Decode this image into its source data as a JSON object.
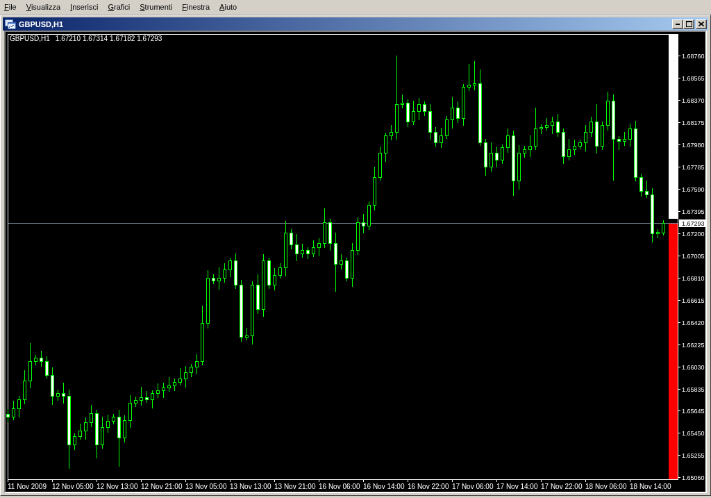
{
  "menu_bar": {
    "items": [
      "File",
      "Visualizza",
      "Inserisci",
      "Grafici",
      "Strumenti",
      "Finestra",
      "Aiuto"
    ]
  },
  "window": {
    "title": "GBPUSD,H1"
  },
  "chart": {
    "legend": {
      "values": [
        "1.67210",
        "1.67314",
        "1.67182",
        "1.67293"
      ]
    },
    "chart_data": {
      "type": "candlestick",
      "series": [
        {
          "name": "GBPUSD,H1",
          "color": "#00ff00",
          "ohlc": [
            [
              1.65616,
              1.65656,
              1.65541,
              1.65591
            ],
            [
              1.65591,
              1.65734,
              1.65561,
              1.65664
            ],
            [
              1.65664,
              1.65774,
              1.65584,
              1.65744
            ],
            [
              1.65744,
              1.65998,
              1.65699,
              1.65908
            ],
            [
              1.65908,
              1.66237,
              1.65843,
              1.66079
            ],
            [
              1.66079,
              1.66134,
              1.66044,
              1.66109
            ],
            [
              1.66109,
              1.66169,
              1.66029,
              1.66079
            ],
            [
              1.66079,
              1.66119,
              1.65927,
              1.65957
            ],
            [
              1.65957,
              1.66027,
              1.65694,
              1.65774
            ],
            [
              1.65774,
              1.65828,
              1.65729,
              1.65798
            ],
            [
              1.65798,
              1.65888,
              1.65709,
              1.65774
            ],
            [
              1.65774,
              1.65829,
              1.65134,
              1.65348
            ],
            [
              1.65348,
              1.65446,
              1.65298,
              1.65421
            ],
            [
              1.65421,
              1.65529,
              1.65391,
              1.65469
            ],
            [
              1.65469,
              1.65583,
              1.65389,
              1.65543
            ],
            [
              1.65543,
              1.65692,
              1.65498,
              1.65622
            ],
            [
              1.65622,
              1.65652,
              1.65226,
              1.65348
            ],
            [
              1.65348,
              1.6559,
              1.65313,
              1.655
            ],
            [
              1.655,
              1.6561,
              1.6545,
              1.65555
            ],
            [
              1.65555,
              1.65616,
              1.65525,
              1.65591
            ],
            [
              1.65591,
              1.65651,
              1.65153,
              1.65408
            ],
            [
              1.65408,
              1.65601,
              1.65363,
              1.65561
            ],
            [
              1.65561,
              1.65783,
              1.65496,
              1.65713
            ],
            [
              1.65713,
              1.65768,
              1.65678,
              1.65738
            ],
            [
              1.65738,
              1.65852,
              1.65688,
              1.65762
            ],
            [
              1.65762,
              1.65817,
              1.65714,
              1.65744
            ],
            [
              1.65744,
              1.65823,
              1.65664,
              1.65798
            ],
            [
              1.65798,
              1.65883,
              1.65753,
              1.65823
            ],
            [
              1.65823,
              1.65887,
              1.65758,
              1.65847
            ],
            [
              1.65847,
              1.65936,
              1.65812,
              1.65866
            ],
            [
              1.65866,
              1.65926,
              1.65816,
              1.65896
            ],
            [
              1.65896,
              1.66016,
              1.65866,
              1.65926
            ],
            [
              1.65926,
              1.66036,
              1.65846,
              1.65981
            ],
            [
              1.65981,
              1.66055,
              1.65936,
              1.6603
            ],
            [
              1.6603,
              1.66139,
              1.65965,
              1.66079
            ],
            [
              1.66079,
              1.66566,
              1.66044,
              1.66414
            ],
            [
              1.66414,
              1.6688,
              1.66364,
              1.6681
            ],
            [
              1.6681,
              1.6684,
              1.66756,
              1.66786
            ],
            [
              1.66786,
              1.669,
              1.66706,
              1.6681
            ],
            [
              1.6681,
              1.66938,
              1.66765,
              1.66883
            ],
            [
              1.66883,
              1.66987,
              1.66818,
              1.66962
            ],
            [
              1.66962,
              1.67022,
              1.66714,
              1.66749
            ],
            [
              1.66749,
              1.66789,
              1.66249,
              1.66292
            ],
            [
              1.66292,
              1.66374,
              1.66262,
              1.66304
            ],
            [
              1.66304,
              1.66779,
              1.66224,
              1.66749
            ],
            [
              1.66749,
              1.66839,
              1.66491,
              1.66536
            ],
            [
              1.66536,
              1.67017,
              1.66471,
              1.66962
            ],
            [
              1.66962,
              1.66987,
              1.66714,
              1.66749
            ],
            [
              1.66749,
              1.66894,
              1.66699,
              1.66834
            ],
            [
              1.66834,
              1.66941,
              1.66804,
              1.66901
            ],
            [
              1.66901,
              1.6731,
              1.66821,
              1.67206
            ],
            [
              1.67206,
              1.67236,
              1.67058,
              1.67103
            ],
            [
              1.67103,
              1.67193,
              1.66958,
              1.67023
            ],
            [
              1.67023,
              1.67109,
              1.66988,
              1.67054
            ],
            [
              1.67054,
              1.67079,
              1.66973,
              1.67023
            ],
            [
              1.67023,
              1.67138,
              1.66993,
              1.67078
            ],
            [
              1.67078,
              1.67155,
              1.66998,
              1.67115
            ],
            [
              1.67115,
              1.67419,
              1.6707,
              1.67298
            ],
            [
              1.67298,
              1.67328,
              1.6705,
              1.67115
            ],
            [
              1.67115,
              1.67205,
              1.66688,
              1.66932
            ],
            [
              1.66932,
              1.67017,
              1.66882,
              1.66962
            ],
            [
              1.66962,
              1.66987,
              1.6678,
              1.6681
            ],
            [
              1.6681,
              1.67114,
              1.6673,
              1.67054
            ],
            [
              1.67054,
              1.67338,
              1.67009,
              1.67298
            ],
            [
              1.67298,
              1.67368,
              1.67202,
              1.67267
            ],
            [
              1.67267,
              1.6748,
              1.67232,
              1.6745
            ],
            [
              1.6745,
              1.67784,
              1.674,
              1.67694
            ],
            [
              1.67694,
              1.67962,
              1.67664,
              1.67907
            ],
            [
              1.67907,
              1.68084,
              1.67827,
              1.68059
            ],
            [
              1.68059,
              1.6815,
              1.68014,
              1.6809
            ],
            [
              1.6809,
              1.6876,
              1.68025,
              1.68333
            ],
            [
              1.68333,
              1.68416,
              1.68298,
              1.68346
            ],
            [
              1.68346,
              1.68376,
              1.68131,
              1.68181
            ],
            [
              1.68181,
              1.68363,
              1.68151,
              1.68273
            ],
            [
              1.68273,
              1.68388,
              1.68193,
              1.68333
            ],
            [
              1.68333,
              1.68358,
              1.68228,
              1.68273
            ],
            [
              1.68273,
              1.68333,
              1.68025,
              1.6809
            ],
            [
              1.6809,
              1.6813,
              1.67963,
              1.67998
            ],
            [
              1.67998,
              1.68129,
              1.67948,
              1.68059
            ],
            [
              1.68059,
              1.68229,
              1.68029,
              1.68199
            ],
            [
              1.68199,
              1.68393,
              1.68119,
              1.68303
            ],
            [
              1.68303,
              1.68358,
              1.68167,
              1.68212
            ],
            [
              1.68212,
              1.68511,
              1.68147,
              1.68486
            ],
            [
              1.68486,
              1.68687,
              1.68451,
              1.68504
            ],
            [
              1.68504,
              1.68711,
              1.68454,
              1.68516
            ],
            [
              1.68516,
              1.68638,
              1.67968,
              1.67998
            ],
            [
              1.67998,
              1.68028,
              1.67705,
              1.67785
            ],
            [
              1.67785,
              1.67997,
              1.6774,
              1.67907
            ],
            [
              1.67907,
              1.67962,
              1.67781,
              1.67846
            ],
            [
              1.67846,
              1.67981,
              1.67811,
              1.67956
            ],
            [
              1.67956,
              1.68119,
              1.67906,
              1.68059
            ],
            [
              1.68059,
              1.68099,
              1.67529,
              1.67663
            ],
            [
              1.67663,
              1.67977,
              1.67583,
              1.67907
            ],
            [
              1.67907,
              1.67967,
              1.67862,
              1.67937
            ],
            [
              1.67937,
              1.68058,
              1.67872,
              1.67968
            ],
            [
              1.67968,
              1.68303,
              1.67933,
              1.6812
            ],
            [
              1.6812,
              1.68157,
              1.6807,
              1.68132
            ],
            [
              1.68132,
              1.68211,
              1.68102,
              1.68151
            ],
            [
              1.68151,
              1.68221,
              1.68071,
              1.68181
            ],
            [
              1.68181,
              1.68251,
              1.68045,
              1.6809
            ],
            [
              1.6809,
              1.6812,
              1.67811,
              1.67876
            ],
            [
              1.67876,
              1.68027,
              1.67841,
              1.67937
            ],
            [
              1.67937,
              1.68023,
              1.67887,
              1.67968
            ],
            [
              1.67968,
              1.68023,
              1.67938,
              1.67998
            ],
            [
              1.67998,
              1.6815,
              1.67918,
              1.6809
            ],
            [
              1.6809,
              1.68221,
              1.68045,
              1.68181
            ],
            [
              1.68181,
              1.68333,
              1.67903,
              1.67968
            ],
            [
              1.67968,
              1.68181,
              1.67933,
              1.68151
            ],
            [
              1.68151,
              1.68443,
              1.68101,
              1.68364
            ],
            [
              1.68364,
              1.68419,
              1.67663,
              1.68029
            ],
            [
              1.68029,
              1.68054,
              1.6793,
              1.6801
            ],
            [
              1.6801,
              1.68089,
              1.67965,
              1.68029
            ],
            [
              1.68029,
              1.6816,
              1.67964,
              1.6812
            ],
            [
              1.6812,
              1.6819,
              1.67659,
              1.67694
            ],
            [
              1.67694,
              1.67724,
              1.67522,
              1.67572
            ],
            [
              1.67572,
              1.67662,
              1.67511,
              1.67541
            ],
            [
              1.67541,
              1.67596,
              1.6712,
              1.672
            ],
            [
              1.672,
              1.67235,
              1.67155,
              1.6721
            ],
            [
              1.6721,
              1.67314,
              1.67182,
              1.67293
            ]
          ]
        }
      ],
      "ylim": [
        1.65043,
        1.68949
      ],
      "yticks": [
        {
          "value": 1.6876,
          "label": "1.68760"
        },
        {
          "value": 1.68565,
          "label": "1.68565"
        },
        {
          "value": 1.6837,
          "label": "1.68370"
        },
        {
          "value": 1.68175,
          "label": "1.68175"
        },
        {
          "value": 1.6798,
          "label": "1.67980"
        },
        {
          "value": 1.67785,
          "label": "1.67785"
        },
        {
          "value": 1.6759,
          "label": "1.67590"
        },
        {
          "value": 1.67395,
          "label": "1.67395"
        },
        {
          "value": 1.672,
          "label": "1.67200"
        },
        {
          "value": 1.67005,
          "label": "1.67005"
        },
        {
          "value": 1.6681,
          "label": "1.66810"
        },
        {
          "value": 1.66615,
          "label": "1.66615"
        },
        {
          "value": 1.6642,
          "label": "1.66420"
        },
        {
          "value": 1.66225,
          "label": "1.66225"
        },
        {
          "value": 1.6603,
          "label": "1.66030"
        },
        {
          "value": 1.65835,
          "label": "1.65835"
        },
        {
          "value": 1.65645,
          "label": "1.65645"
        },
        {
          "value": 1.6545,
          "label": "1.65450"
        },
        {
          "value": 1.65255,
          "label": "1.65255"
        },
        {
          "value": 1.6506,
          "label": "1.65060"
        }
      ],
      "ref_lines": [
        {
          "axis": "y",
          "value": 1.67293,
          "label": "1.67293",
          "color": "#778899"
        }
      ]
    },
    "time_labels": [
      "11 Nov 2009",
      "12 Nov 05:00",
      "12 Nov 13:00",
      "12 Nov 21:00",
      "13 Nov 05:00",
      "13 Nov 13:00",
      "13 Nov 21:00",
      "16 Nov 06:00",
      "16 Nov 14:00",
      "16 Nov 22:00",
      "17 Nov 06:00",
      "17 Nov 14:00",
      "17 Nov 22:00",
      "18 Nov 06:00",
      "18 Nov 14:00"
    ]
  }
}
